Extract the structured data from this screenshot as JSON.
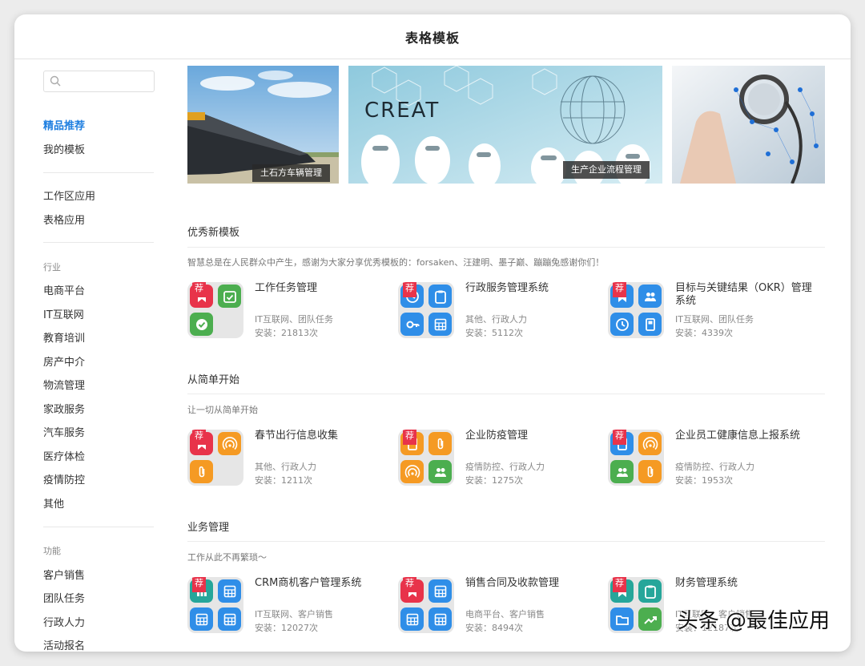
{
  "window": {
    "title": "表格模板"
  },
  "sidebar": {
    "search_placeholder": "",
    "top_items": [
      {
        "label": "精品推荐",
        "active": true
      },
      {
        "label": "我的模板"
      }
    ],
    "app_items": [
      {
        "label": "工作区应用"
      },
      {
        "label": "表格应用"
      }
    ],
    "industry_heading": "行业",
    "industries": [
      "电商平台",
      "IT互联网",
      "教育培训",
      "房产中介",
      "物流管理",
      "家政服务",
      "汽车服务",
      "医疗体检",
      "疫情防控",
      "其他"
    ],
    "function_heading": "功能",
    "functions": [
      "客户销售",
      "团队任务",
      "行政人力",
      "活动报名"
    ]
  },
  "banners": [
    {
      "label": "土石方车辆管理"
    },
    {
      "label": "生产企业流程管理",
      "overlay_text": "CREAT"
    },
    {
      "label": ""
    }
  ],
  "sections": [
    {
      "title": "优秀新模板",
      "desc": "智慧总是在人民群众中产生，感谢为大家分享优秀模板的：forsaken、汪建明、墨子巅、蹦蹦兔感谢你们！",
      "cards": [
        {
          "name": "工作任务管理",
          "tags": "IT互联网、团队任务",
          "installs": "安装：21813次",
          "badge": "荐",
          "icons": [
            {
              "c": "#e8334a",
              "i": "bookmark"
            },
            {
              "c": "#4cae4f",
              "i": "calendar-check"
            },
            {
              "c": "#4cae4f",
              "i": "check-circle"
            }
          ]
        },
        {
          "name": "行政服务管理系统",
          "tags": "其他、行政人力",
          "installs": "安装：5112次",
          "badge": "荐",
          "icons": [
            {
              "c": "#2f8ee8",
              "i": "clock"
            },
            {
              "c": "#2f8ee8",
              "i": "clipboard"
            },
            {
              "c": "#2f8ee8",
              "i": "key"
            },
            {
              "c": "#2f8ee8",
              "i": "table"
            }
          ]
        },
        {
          "name": "目标与关键结果（OKR）管理系统",
          "tags": "IT互联网、团队任务",
          "installs": "安装：4339次",
          "badge": "荐",
          "icons": [
            {
              "c": "#2f8ee8",
              "i": "bookmark"
            },
            {
              "c": "#2f8ee8",
              "i": "people"
            },
            {
              "c": "#2f8ee8",
              "i": "clock"
            },
            {
              "c": "#2f8ee8",
              "i": "book"
            }
          ]
        }
      ]
    },
    {
      "title": "从简单开始",
      "desc": "让一切从简单开始",
      "cards": [
        {
          "name": "春节出行信息收集",
          "tags": "其他、行政人力",
          "installs": "安装：1211次",
          "badge": "荐",
          "icons": [
            {
              "c": "#e8334a",
              "i": "bookmark"
            },
            {
              "c": "#f59a23",
              "i": "signal"
            },
            {
              "c": "#f59a23",
              "i": "clip"
            }
          ]
        },
        {
          "name": "企业防疫管理",
          "tags": "疫情防控、行政人力",
          "installs": "安装：1275次",
          "badge": "荐",
          "icons": [
            {
              "c": "#f59a23",
              "i": "book"
            },
            {
              "c": "#f59a23",
              "i": "clip"
            },
            {
              "c": "#f59a23",
              "i": "signal"
            },
            {
              "c": "#4cae4f",
              "i": "people"
            }
          ]
        },
        {
          "name": "企业员工健康信息上报系统",
          "tags": "疫情防控、行政人力",
          "installs": "安装：1953次",
          "badge": "荐",
          "icons": [
            {
              "c": "#2f8ee8",
              "i": "book"
            },
            {
              "c": "#f59a23",
              "i": "signal"
            },
            {
              "c": "#4cae4f",
              "i": "people"
            },
            {
              "c": "#f59a23",
              "i": "clip"
            }
          ]
        }
      ]
    },
    {
      "title": "业务管理",
      "desc": "工作从此不再繁琐～",
      "cards": [
        {
          "name": "CRM商机客户管理系统",
          "tags": "IT互联网、客户销售",
          "installs": "安装：12027次",
          "badge": "荐",
          "icons": [
            {
              "c": "#26a69a",
              "i": "chart"
            },
            {
              "c": "#2f8ee8",
              "i": "table"
            },
            {
              "c": "#2f8ee8",
              "i": "table"
            },
            {
              "c": "#2f8ee8",
              "i": "table"
            }
          ]
        },
        {
          "name": "销售合同及收款管理",
          "tags": "电商平台、客户销售",
          "installs": "安装：8494次",
          "badge": "荐",
          "icons": [
            {
              "c": "#e8334a",
              "i": "bookmark"
            },
            {
              "c": "#2f8ee8",
              "i": "table"
            },
            {
              "c": "#2f8ee8",
              "i": "table"
            },
            {
              "c": "#2f8ee8",
              "i": "table"
            }
          ]
        },
        {
          "name": "财务管理系统",
          "tags": "IT互联网、客户销售",
          "installs": "安装：12187次",
          "badge": "荐",
          "icons": [
            {
              "c": "#26a69a",
              "i": "bookmark"
            },
            {
              "c": "#26a69a",
              "i": "clipboard"
            },
            {
              "c": "#2f8ee8",
              "i": "folder"
            },
            {
              "c": "#4cae4f",
              "i": "trend"
            }
          ]
        }
      ]
    }
  ],
  "watermark": "头条 @最佳应用"
}
